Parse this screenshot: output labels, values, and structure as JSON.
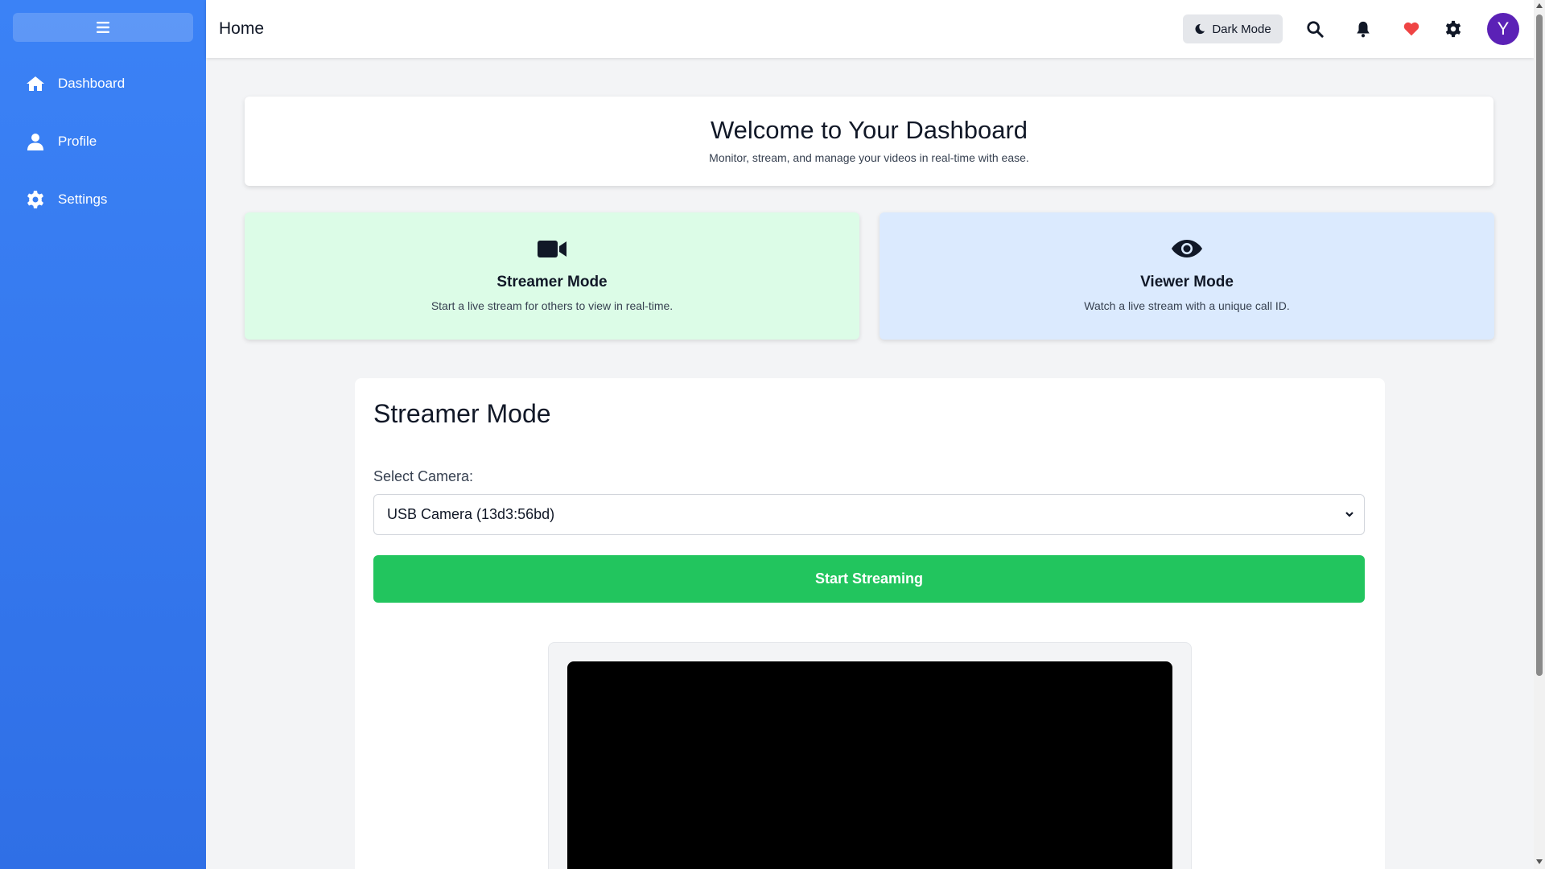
{
  "sidebar": {
    "items": [
      {
        "label": "Dashboard",
        "icon": "home-icon"
      },
      {
        "label": "Profile",
        "icon": "user-icon"
      },
      {
        "label": "Settings",
        "icon": "gear-icon"
      }
    ]
  },
  "header": {
    "title": "Home",
    "dark_mode_label": "Dark Mode",
    "avatar_initial": "Y",
    "heart_color": "#ef4444",
    "avatar_color": "#5b21b6"
  },
  "welcome": {
    "title": "Welcome to Your Dashboard",
    "subtitle": "Monitor, stream, and manage your videos in real-time with ease."
  },
  "modes": {
    "streamer": {
      "title": "Streamer Mode",
      "description": "Start a live stream for others to view in real-time.",
      "icon": "video-camera-icon",
      "color": "#dcfce7"
    },
    "viewer": {
      "title": "Viewer Mode",
      "description": "Watch a live stream with a unique call ID.",
      "icon": "eye-icon",
      "color": "#dbeafe"
    }
  },
  "panel": {
    "title": "Streamer Mode",
    "camera_label": "Select Camera:",
    "camera_selected": "USB Camera (13d3:56bd)",
    "start_button": "Start Streaming",
    "accent": "#22c55e"
  }
}
